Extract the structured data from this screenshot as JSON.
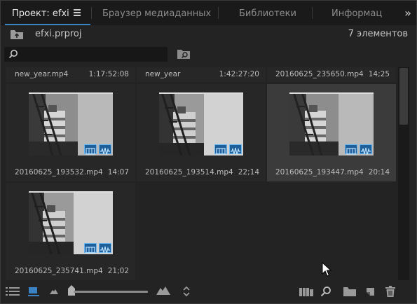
{
  "tabs": [
    {
      "label": "Проект: efxi",
      "active": true
    },
    {
      "label": "Браузер медиаданных",
      "active": false
    },
    {
      "label": "Библиотеки",
      "active": false
    },
    {
      "label": "Информац",
      "active": false
    }
  ],
  "overflow_label": "»",
  "project": {
    "name": "efxi.prproj",
    "item_count": "7 элементов"
  },
  "search": {
    "value": "",
    "placeholder": ""
  },
  "top_row": [
    {
      "name": "new_year.mp4",
      "duration": "1:17:52:08"
    },
    {
      "name": "new_year",
      "duration": "1:42:27:20"
    },
    {
      "name": "20160625_235650.mp4",
      "duration": "14;25"
    }
  ],
  "clips": [
    {
      "name": "20160625_193532.mp4",
      "duration": "14:07",
      "selected": false
    },
    {
      "name": "20160625_193514.mp4",
      "duration": "22;14",
      "selected": false
    },
    {
      "name": "20160625_193447.mp4",
      "duration": "20:14",
      "selected": true
    },
    {
      "name": "20160625_235741.mp4",
      "duration": "21;02",
      "selected": false
    }
  ],
  "zoom_level": 0.0,
  "colors": {
    "accent": "#3b82c4",
    "badge_fill": "#1d5f9b",
    "badge_border": "#6ab6f0",
    "panel_bg": "#232323",
    "selected_bg": "#3b3b3b"
  },
  "toolbar_icons": [
    "list-view-icon",
    "icon-view-icon",
    "small-thumb-icon",
    "zoom-slider-handle",
    "large-thumb-icon",
    "sort-icon",
    "auto-sequence-icon",
    "find-icon",
    "new-bin-icon",
    "new-item-icon",
    "trash-icon"
  ]
}
